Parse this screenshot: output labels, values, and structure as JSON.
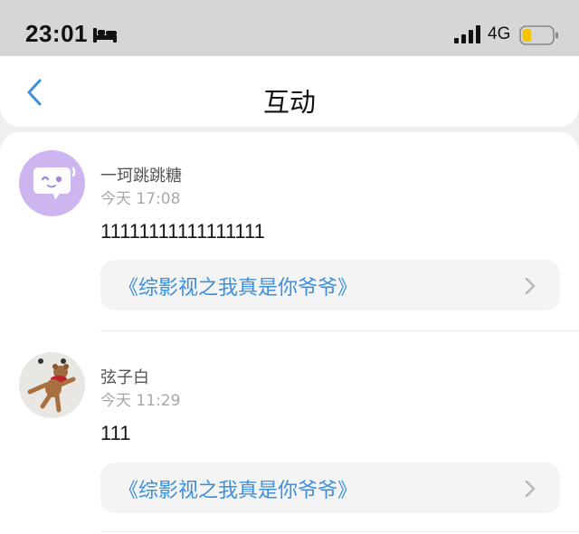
{
  "status_bar": {
    "time": "23:01",
    "network": "4G",
    "icons": [
      "bed-icon",
      "signal-icon",
      "battery-icon"
    ],
    "battery_level": 0.3,
    "battery_color": "#f5c400"
  },
  "nav": {
    "title": "互动",
    "back_icon": "chevron-left-icon",
    "accent": "#3b8fdc"
  },
  "comments": [
    {
      "username": "一珂跳跳糖",
      "time": "今天 17:08",
      "text": "11111111111111111",
      "link_title": "《综影视之我真是你爷爷》",
      "avatar_icon": "purple-chat-bubble-avatar",
      "avatar_color": "#cdb6ef"
    },
    {
      "username": "弦子白",
      "time": "今天 11:29",
      "text": "111",
      "link_title": "《综影视之我真是你爷爷》",
      "avatar_icon": "teddy-bear-photo-avatar",
      "avatar_color": "#e9e7e4"
    }
  ],
  "colors": {
    "link": "#3b8fdc",
    "username": "#555555",
    "timestamp": "#a8a8a8",
    "background": "#efefef"
  }
}
